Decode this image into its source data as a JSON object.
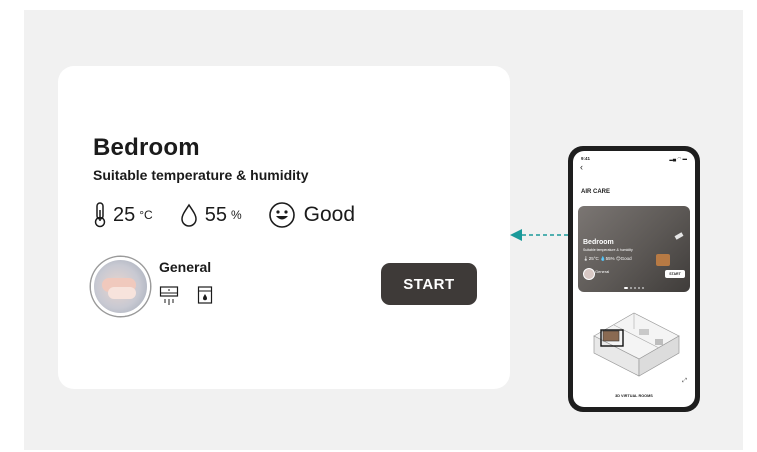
{
  "card": {
    "room_name": "Bedroom",
    "subtitle": "Suitable temperature & humidity",
    "temperature_value": "25",
    "temperature_unit": "°C",
    "humidity_value": "55",
    "humidity_unit": "%",
    "air_quality": "Good",
    "mode_name": "General",
    "start_label": "START"
  },
  "phone": {
    "status_time": "9:41",
    "status_icons": "▂▄ ◠ ▬",
    "screen_title": "AIR CARE",
    "card_title": "Bedroom",
    "card_subtitle": "Suitable temperature & humidity",
    "card_stats": "🌡25°C  💧55%  😊Good",
    "mode_name": "General",
    "start_label": "START",
    "footer_label": "3D VIRTUAL ROOMS"
  },
  "colors": {
    "background_panel": "#f1f1f1",
    "card": "#ffffff",
    "start_button": "#3e3a38",
    "arrow": "#1a9a9a",
    "phone_frame": "#1e1e1e"
  },
  "icons": [
    "thermometer-icon",
    "water-drop-icon",
    "smiley-icon",
    "ac-unit-icon",
    "humidifier-icon",
    "back-icon",
    "expand-icon"
  ]
}
